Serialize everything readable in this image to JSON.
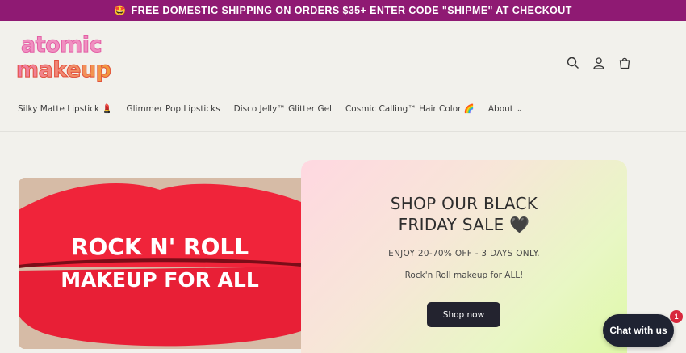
{
  "announcement": {
    "emoji": "🤩",
    "text": "FREE DOMESTIC SHIPPING ON ORDERS $35+ ENTER CODE \"SHIPME\" AT CHECKOUT"
  },
  "logo": {
    "line1": "atomic",
    "line2": "makeup"
  },
  "header_icons": [
    "search-icon",
    "account-icon",
    "cart-icon"
  ],
  "nav": {
    "items": [
      {
        "label": "Silky Matte Lipstick 💄"
      },
      {
        "label": "Glimmer Pop Lipsticks"
      },
      {
        "label": "Disco Jelly™ Glitter Gel"
      },
      {
        "label": "Cosmic Calling™ Hair Color 🌈"
      },
      {
        "label": "About"
      }
    ]
  },
  "hero": {
    "image_text_line1": "ROCK N' ROLL",
    "image_text_line2": "MAKEUP FOR ALL",
    "title": "SHOP OUR BLACK FRIDAY SALE 🖤",
    "subtitle": "ENJOY 20-70% OFF - 3 DAYS ONLY.",
    "tagline": "Rock'n Roll makeup for ALL!",
    "button": "Shop now"
  },
  "chat": {
    "label": "Chat with us",
    "badge": "1"
  },
  "colors": {
    "announcement_bg": "#8f1a73",
    "lips": "#f0243a",
    "button_bg": "#23232f",
    "chat_bg": "#1f2332"
  }
}
